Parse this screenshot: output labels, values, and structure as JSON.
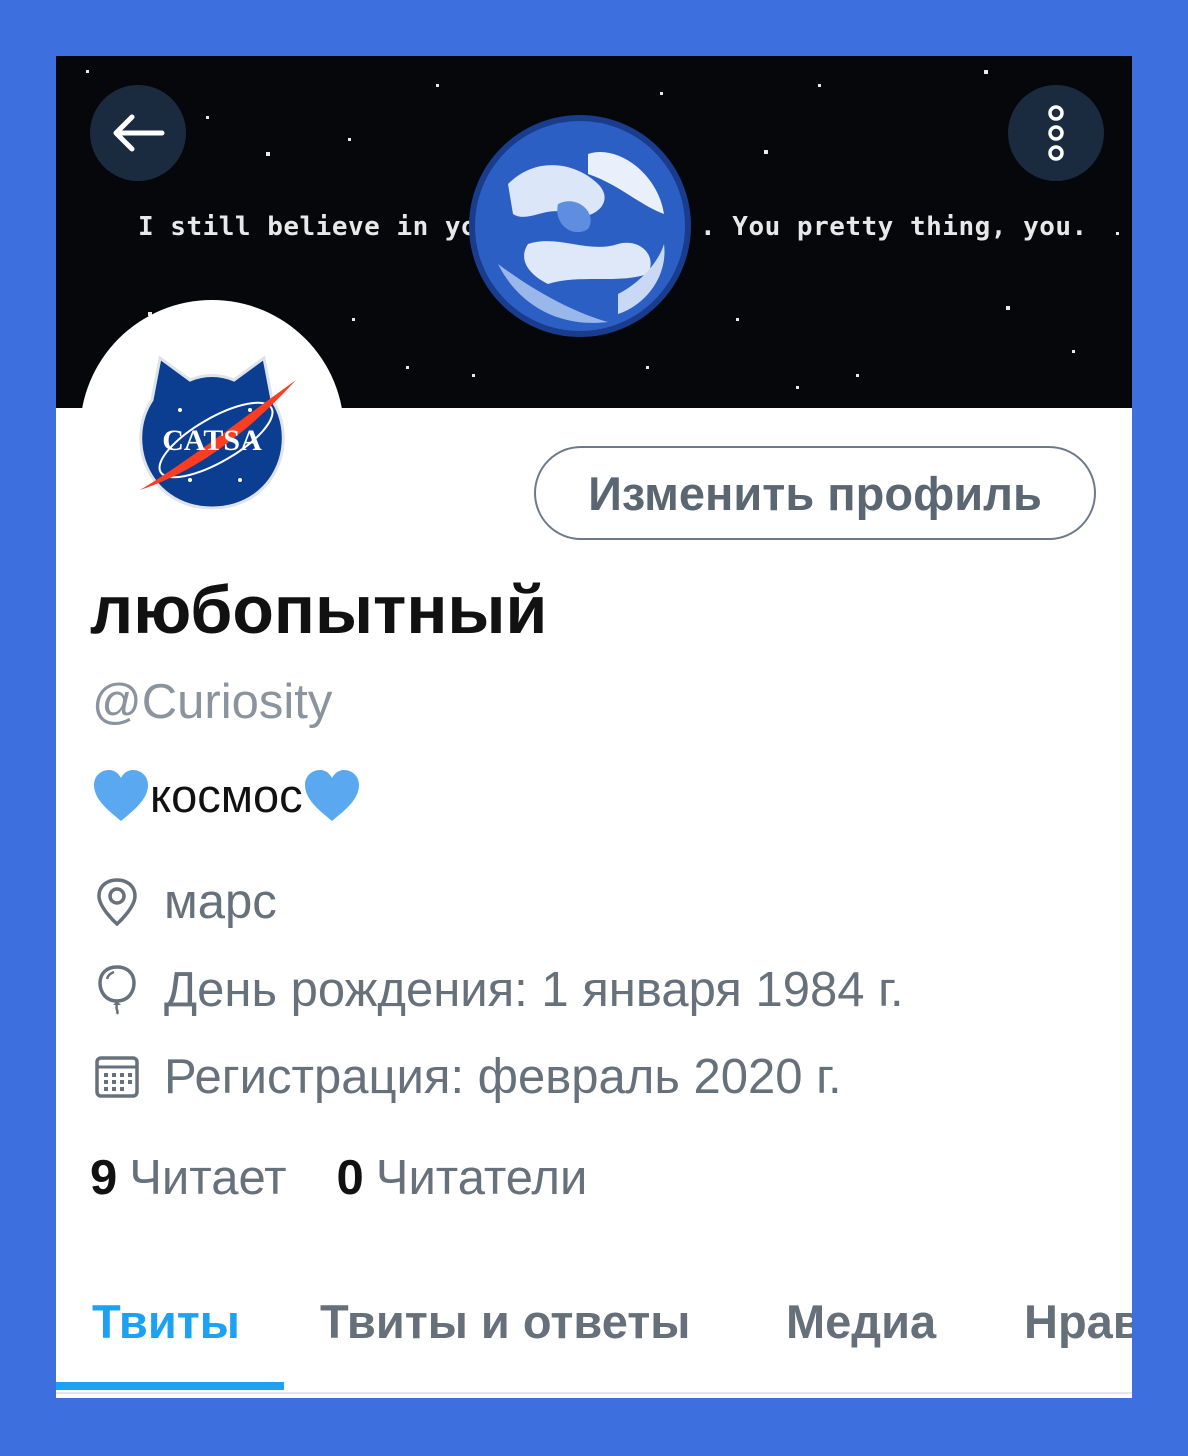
{
  "banner": {
    "text_left": "I still believe in you,",
    "text_right": ". You pretty thing, you."
  },
  "avatar": {
    "logo_text": "CATSA"
  },
  "edit_profile_label": "Изменить профиль",
  "profile": {
    "display_name": "любопытный",
    "handle": "@Curiosity",
    "bio_text": "космос",
    "location": "марс",
    "birthday": "День рождения: 1 января 1984 г.",
    "joined": "Регистрация: февраль 2020 г."
  },
  "stats": {
    "following_count": "9",
    "following_label": "Читает",
    "followers_count": "0",
    "followers_label": "Читатели"
  },
  "tabs": [
    {
      "label": "Твиты",
      "active": true
    },
    {
      "label": "Твиты и ответы",
      "active": false
    },
    {
      "label": "Медиа",
      "active": false
    },
    {
      "label": "Нравится",
      "active": false
    }
  ],
  "icons": {
    "back": "arrow-left-icon",
    "more": "more-vertical-icon",
    "location": "location-pin-icon",
    "birthday": "balloon-icon",
    "joined": "calendar-icon",
    "bio_hearts": "blue-heart-icon"
  },
  "colors": {
    "page_background": "#3e6fde",
    "accent": "#1da1f2",
    "heart": "#5aa9f0"
  }
}
